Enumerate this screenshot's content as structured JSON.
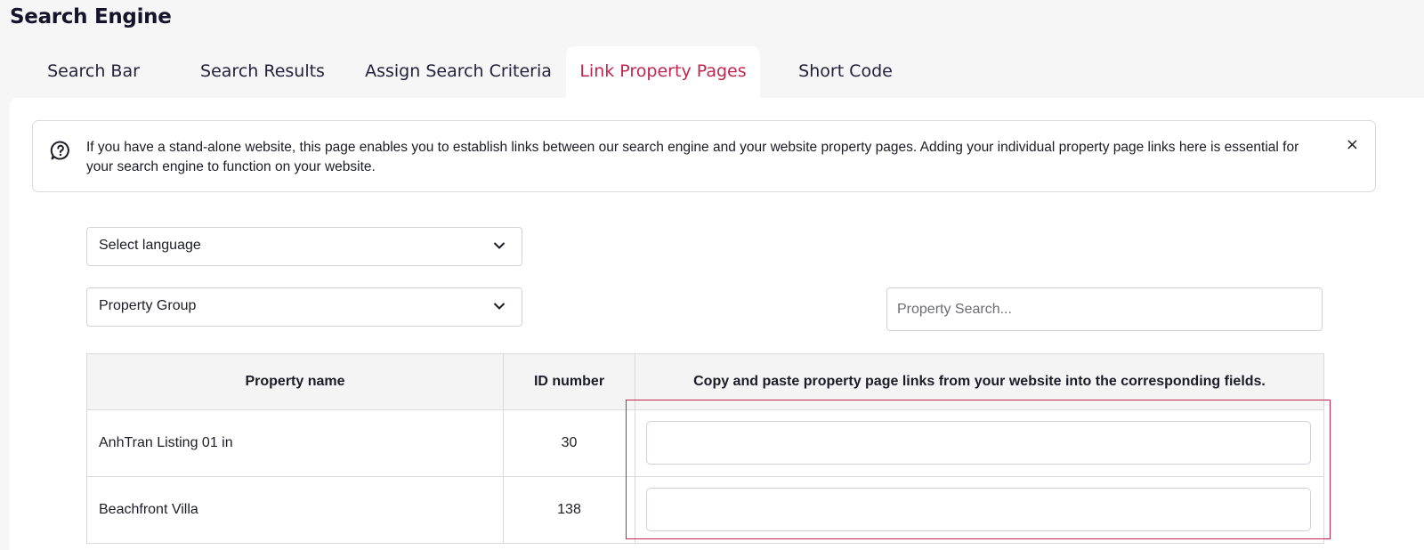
{
  "header": {
    "title": "Search Engine"
  },
  "tabs": [
    {
      "label": "Search Bar"
    },
    {
      "label": "Search Results"
    },
    {
      "label": "Assign Search Criteria"
    },
    {
      "label": "Link Property Pages",
      "active": true
    },
    {
      "label": "Short Code"
    }
  ],
  "notice": {
    "text": "If you have a stand-alone website, this page enables you to establish links between our search engine and your website property pages. Adding your individual property page links here is essential for your search engine to function on your website.",
    "close_symbol": "×",
    "icon": "question-bubble-icon"
  },
  "filters": {
    "language": "Select language",
    "property_group": "Property Group",
    "search_placeholder": "Property Search..."
  },
  "table": {
    "headers": [
      "Property name",
      "ID number",
      "Copy and paste property page links from your website into the corresponding fields."
    ],
    "rows": [
      {
        "name": "AnhTran Listing 01 in",
        "id": "30",
        "link": ""
      },
      {
        "name": "Beachfront Villa",
        "id": "138",
        "link": ""
      }
    ]
  },
  "colors": {
    "accent": "#c2264e",
    "title": "#15142b",
    "background": "#f6f6f7"
  }
}
